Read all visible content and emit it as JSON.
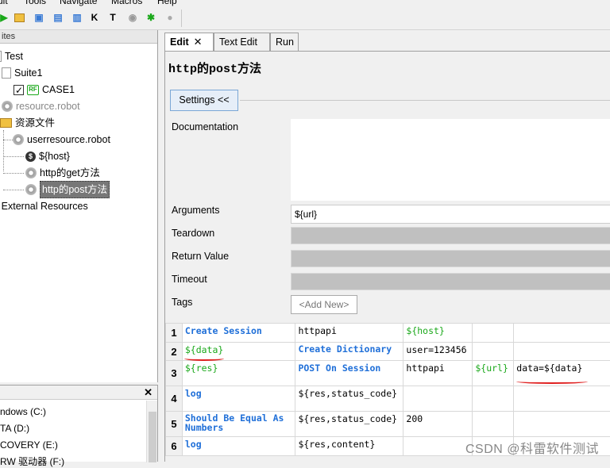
{
  "menu": [
    "uit",
    "Tools",
    "Navigate",
    "Macros",
    "Help"
  ],
  "tree": {
    "header": "ites",
    "nodes": [
      {
        "label": "Test"
      },
      {
        "label": "Suite1"
      },
      {
        "label": "CASE1"
      },
      {
        "label": "resource.robot"
      },
      {
        "label": "资源文件"
      },
      {
        "label": "userresource.robot"
      },
      {
        "label": "${host}"
      },
      {
        "label": "http的get方法"
      },
      {
        "label": "http的post方法"
      },
      {
        "label": "External Resources"
      }
    ]
  },
  "drives": [
    "ndows (C:)",
    "TA (D:)",
    "COVERY (E:)",
    "RW 驱动器 (F:)"
  ],
  "tabs": [
    "Edit",
    "Text Edit",
    "Run"
  ],
  "keyword_title": "http的post方法",
  "settings_button": "Settings <<",
  "fields": {
    "documentation": "Documentation",
    "arguments": "Arguments",
    "arguments_value": "${url}",
    "teardown": "Teardown",
    "return_value": "Return Value",
    "timeout": "Timeout",
    "tags": "Tags",
    "add_new": "<Add New>"
  },
  "rows": [
    {
      "n": "1",
      "cells": [
        "Create Session",
        "httpapi",
        "${host}",
        "",
        ""
      ]
    },
    {
      "n": "2",
      "cells": [
        "${data}",
        "Create Dictionary",
        "user=123456",
        "",
        ""
      ]
    },
    {
      "n": "3",
      "cells": [
        "${res}",
        "POST On Session",
        "httpapi",
        "${url}",
        "data=${data}"
      ]
    },
    {
      "n": "4",
      "cells": [
        "log",
        "${res,status_code}",
        "",
        "",
        ""
      ]
    },
    {
      "n": "5",
      "cells": [
        "Should Be Equal As Numbers",
        "${res,status_code}",
        "200",
        "",
        ""
      ]
    },
    {
      "n": "6",
      "cells": [
        "log",
        "${res,content}",
        "",
        "",
        ""
      ]
    }
  ],
  "watermark": "CSDN @科雷软件测试",
  "colors": {
    "keyword": "#1f6fd8",
    "variable": "#1aa81a",
    "annotation": "#e02020"
  }
}
